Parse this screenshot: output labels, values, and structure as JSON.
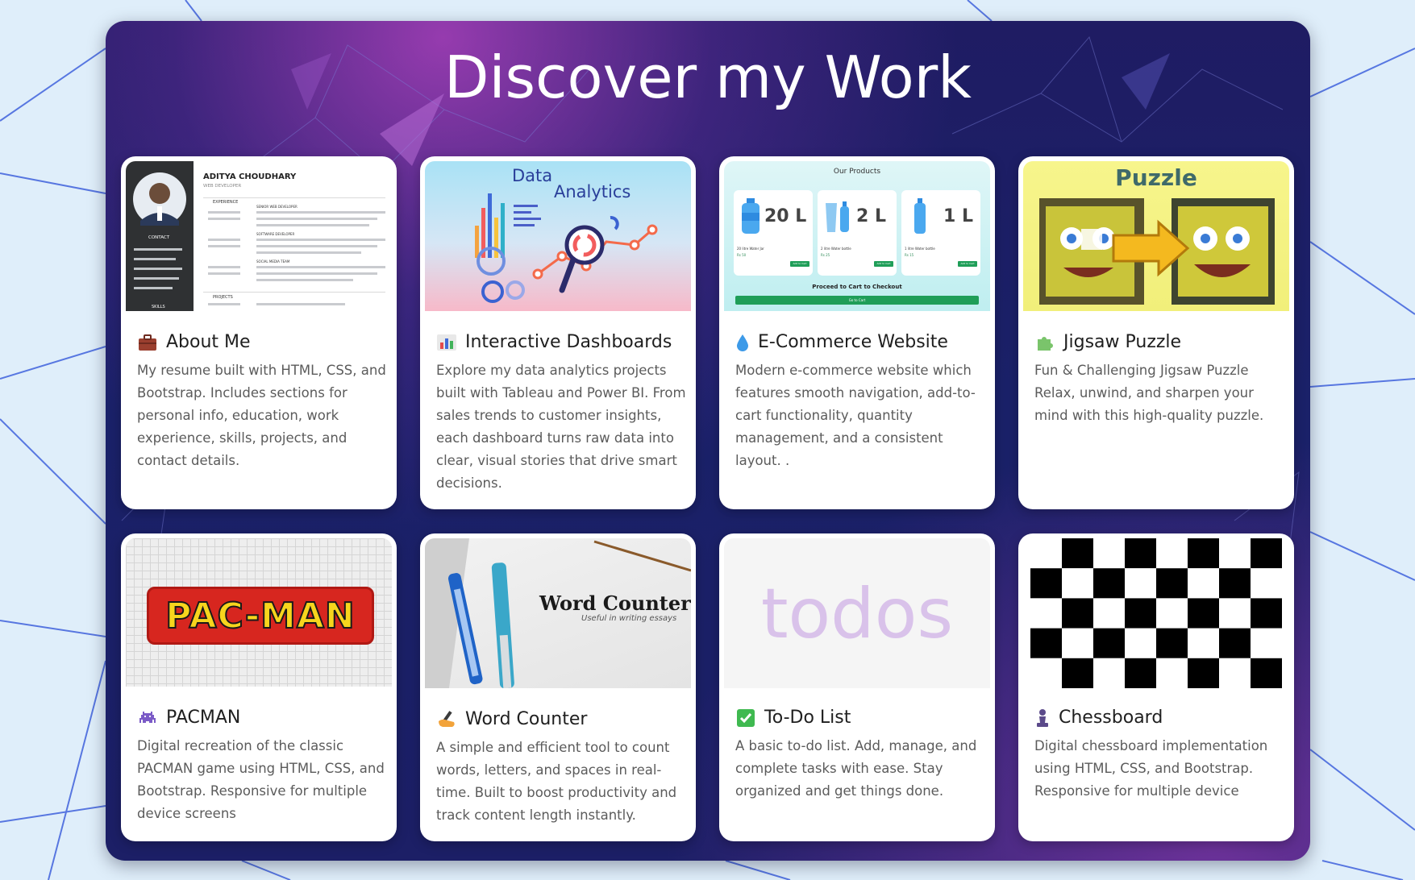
{
  "page": {
    "title": "Discover my Work"
  },
  "cards": [
    {
      "title": "About Me",
      "icon": "briefcase-icon",
      "description": "My resume built with HTML, CSS, and Bootstrap. Includes sections for personal info, education, work experience, skills, projects, and contact details.",
      "thumb": {
        "name": "ADITYA CHOUDHARY",
        "role": "WEB DEVELOPER",
        "experience": "EXPERIENCE",
        "contact": "CONTACT",
        "projects": "PROJECTS",
        "skills": "SKILLS",
        "jobs": [
          "SENIOR WEB DEVELOPER",
          "SOFTWARE DEVELOPER",
          "SOCIAL MEDIA TEAM"
        ]
      }
    },
    {
      "title": "Interactive Dashboards",
      "icon": "bar-chart-icon",
      "description": "Explore my data analytics projects built with Tableau and Power BI. From sales trends to customer insights, each dashboard turns raw data into clear, visual stories that drive smart decisions.",
      "thumb": {
        "line1": "Data",
        "line2": "Analytics"
      }
    },
    {
      "title": "E-Commerce Website",
      "icon": "droplet-icon",
      "description": "Modern e-commerce website which features smooth navigation, add-to-cart functionality, quantity management, and a consistent layout. .",
      "thumb": {
        "heading": "Our Products",
        "products": [
          {
            "size": "20 L",
            "name": "20 litre Water Jar",
            "price": "Rs 50"
          },
          {
            "size": "2 L",
            "name": "2 litre Water bottle",
            "price": "Rs 25"
          },
          {
            "size": "1 L",
            "name": "1 litre Water bottle",
            "price": "Rs 15"
          }
        ],
        "add_label": "Add to Cart",
        "checkout": "Proceed to Cart to Checkout",
        "go_to_cart": "Go to Cart"
      }
    },
    {
      "title": "Jigsaw Puzzle",
      "icon": "puzzle-piece-icon",
      "description": "Fun & Challenging Jigsaw Puzzle Relax, unwind, and sharpen your mind with this high-quality puzzle.",
      "thumb": {
        "heading": "Puzzle"
      }
    },
    {
      "title": "PACMAN",
      "icon": "space-invader-icon",
      "description": "Digital recreation of the classic PACMAN game using HTML, CSS, and Bootstrap. Responsive for multiple device screens",
      "thumb": {
        "logo": "PAC-MAN"
      }
    },
    {
      "title": "Word Counter",
      "icon": "writing-hand-icon",
      "description": "A simple and efficient tool to count words, letters, and spaces in real-time. Built to boost productivity and track content length instantly.",
      "thumb": {
        "heading": "Word Counter",
        "subheading": "Useful in writing essays"
      }
    },
    {
      "title": "To-Do List",
      "icon": "check-mark-icon",
      "description": "A basic to-do list. Add, manage, and complete tasks with ease. Stay organized and get things done.",
      "thumb": {
        "logo": "todos"
      }
    },
    {
      "title": "Chessboard",
      "icon": "chess-pawn-icon",
      "description": "Digital chessboard implementation using HTML, CSS, and Bootstrap. Responsive for multiple device",
      "thumb": {}
    }
  ]
}
